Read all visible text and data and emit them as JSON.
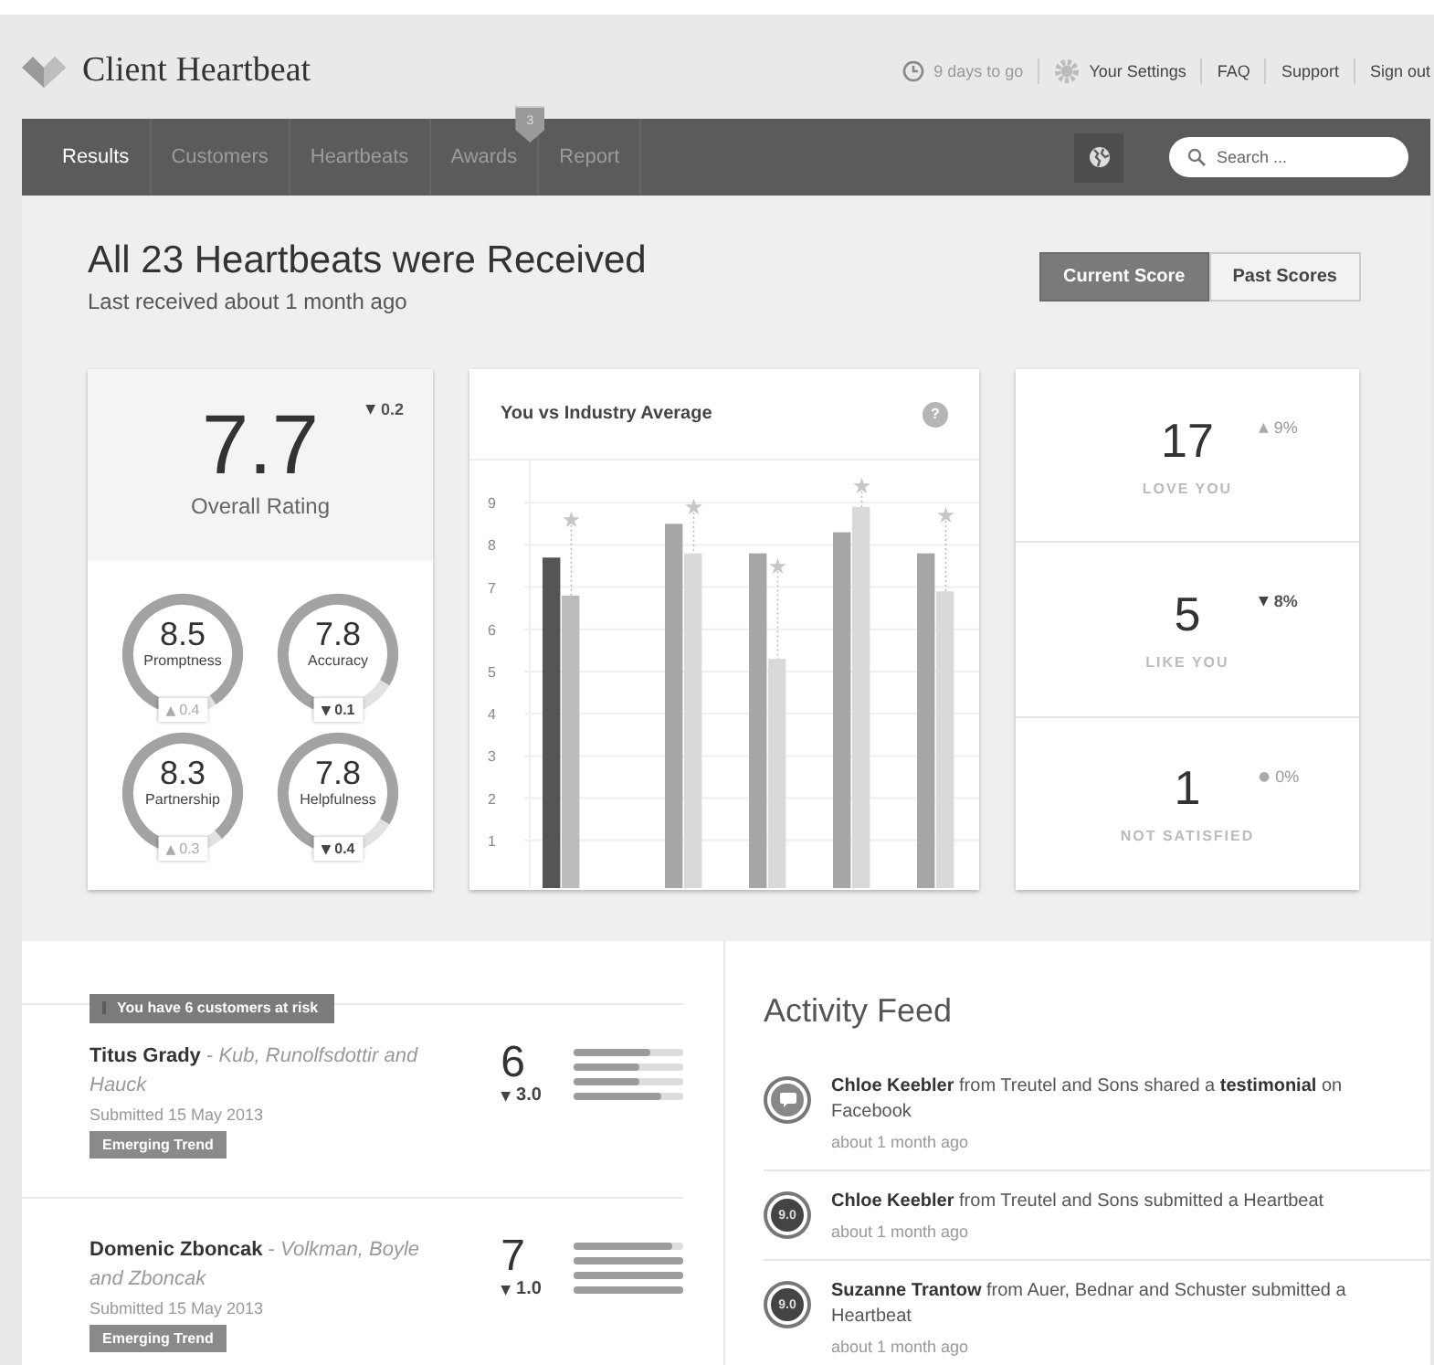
{
  "header": {
    "logo_text": "Client Heartbeat",
    "trial": "9 days to go",
    "links": [
      {
        "label": "Your Settings",
        "kind": "settings"
      },
      {
        "label": "FAQ",
        "kind": "link"
      },
      {
        "label": "Support",
        "kind": "link"
      },
      {
        "label": "Sign out",
        "kind": "link"
      }
    ]
  },
  "nav": {
    "tabs": [
      {
        "label": "Results",
        "selected": true
      },
      {
        "label": "Customers",
        "selected": false
      },
      {
        "label": "Heartbeats",
        "selected": false
      },
      {
        "label": "Awards",
        "selected": false,
        "badge": "3"
      },
      {
        "label": "Report",
        "selected": false
      }
    ],
    "search": {
      "placeholder": "Search ..."
    }
  },
  "summary": {
    "title": "All 23 Heartbeats were Received",
    "subtitle": "Last received about 1 month ago",
    "toggle": [
      {
        "label": "Current Score",
        "selected": true
      },
      {
        "label": "Past Scores",
        "selected": false
      }
    ]
  },
  "rating": {
    "value": "7.7",
    "label": "Overall Rating",
    "change": "0.2",
    "trend": "▼",
    "declined": true,
    "metrics": [
      {
        "value": "8.5",
        "label": "Promptness",
        "change": "0.4",
        "trend": "▲",
        "declined": false,
        "level": 0.85
      },
      {
        "value": "7.8",
        "label": "Accuracy",
        "change": "0.1",
        "trend": "▼",
        "declined": true,
        "level": 0.78
      },
      {
        "value": "8.3",
        "label": "Partnership",
        "change": "0.3",
        "trend": "▲",
        "declined": false,
        "level": 0.83
      },
      {
        "value": "7.8",
        "label": "Helpfulness",
        "change": "0.4",
        "trend": "▼",
        "declined": true,
        "level": 0.78
      }
    ]
  },
  "chart": {
    "title": "You vs Industry Average",
    "help": "?",
    "chart_data": {
      "type": "bar",
      "grid": true,
      "ylim": [
        0,
        10
      ],
      "yticks": [
        1,
        2,
        3,
        4,
        5,
        6,
        7,
        8,
        9
      ],
      "series": [
        {
          "color": "#555555",
          "values": [
            7.7,
            null,
            null,
            null,
            null
          ]
        },
        {
          "color": "#bcbcbc",
          "values": [
            6.8,
            null,
            null,
            null,
            null
          ]
        },
        {
          "color": "#a6a6a6",
          "values": [
            null,
            8.5,
            7.8,
            8.3,
            7.8
          ]
        },
        {
          "color": "#d9d9d9",
          "values": [
            null,
            7.8,
            5.3,
            8.9,
            6.9
          ]
        }
      ]
    },
    "star_markers": [
      {
        "symbol": "★"
      },
      {
        "symbol": "★"
      },
      {
        "symbol": "★"
      },
      {
        "symbol": "★"
      },
      {
        "symbol": "★"
      }
    ]
  },
  "stats": [
    {
      "value": "17",
      "label": "LOVE YOU",
      "change": "9%",
      "trend": "▲",
      "declined": false
    },
    {
      "value": "5",
      "label": "LIKE YOU",
      "change": "8%",
      "trend": "▼",
      "declined": true
    },
    {
      "value": "1",
      "label": "NOT SATISFIED",
      "change": "0%",
      "trend": "●",
      "declined": false
    }
  ],
  "risk": {
    "banner": "You have 6 customers at risk",
    "customers": [
      {
        "text": "**Titus Grady** - *Kub, Runolfsdottir and Hauck*",
        "submitted": "Submitted 15 May 2013",
        "tag": "Emerging Trend",
        "score": "6",
        "change": "3.0",
        "trend": "▼",
        "declined": true,
        "bars": [
          {
            "level": 0.7
          },
          {
            "level": 0.6
          },
          {
            "level": 0.6
          },
          {
            "level": 0.8
          }
        ]
      },
      {
        "text": "**Domenic Zboncak** - *Volkman, Boyle and Zboncak*",
        "submitted": "Submitted 15 May 2013",
        "tag": "Emerging Trend",
        "score": "7",
        "change": "1.0",
        "trend": "▼",
        "declined": true,
        "bars": [
          {
            "level": 0.9
          },
          {
            "level": 1
          },
          {
            "level": 1
          },
          {
            "level": 1
          }
        ]
      }
    ]
  },
  "activity_feed": {
    "title": "Activity Feed",
    "items": [
      {
        "kind": "comment",
        "text": "**Chloe Keebler** from Treutel and Sons shared a **testimonial** on Facebook",
        "time": "about 1 month ago"
      },
      {
        "kind": "score",
        "score": "9.0",
        "text": "**Chloe Keebler** from Treutel and Sons submitted a Heartbeat",
        "time": "about 1 month ago"
      },
      {
        "kind": "score",
        "score": "9.0",
        "text": "**Suzanne Trantow** from Auer, Bednar and Schuster submitted a Heartbeat",
        "time": "about 1 month ago"
      }
    ]
  }
}
